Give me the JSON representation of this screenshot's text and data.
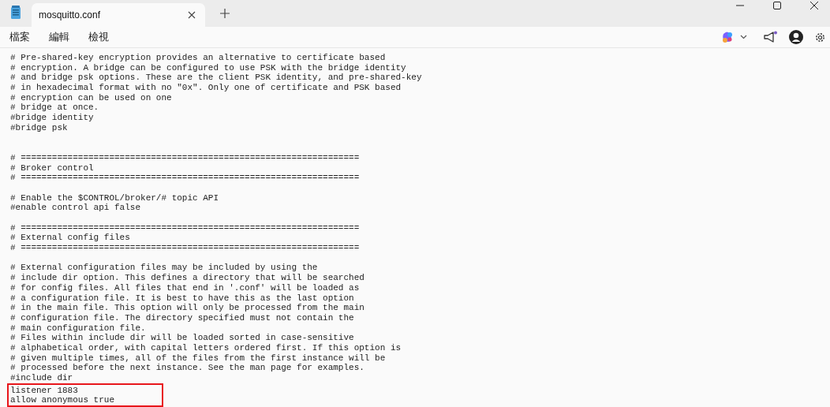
{
  "window": {
    "tabs": [
      {
        "label": "mosquitto.conf",
        "selected": true
      }
    ]
  },
  "menu": [
    {
      "label": "檔案"
    },
    {
      "label": "編輯"
    },
    {
      "label": "檢視"
    }
  ],
  "editor": {
    "lines": [
      {
        "kind": "text",
        "text": "# Pre-shared-key encryption provides an alternative to certificate based"
      },
      {
        "kind": "text",
        "text": "# encryption. A bridge can be configured to use PSK with the bridge identity"
      },
      {
        "kind": "text",
        "text": "# and bridge psk options. These are the client PSK identity, and pre-shared-key"
      },
      {
        "kind": "text",
        "text": "# in hexadecimal format with no \"0x\". Only one of certificate and PSK based"
      },
      {
        "kind": "text",
        "text": "# encryption can be used on one"
      },
      {
        "kind": "text",
        "text": "# bridge at once."
      },
      {
        "kind": "text",
        "text": "#bridge identity"
      },
      {
        "kind": "text",
        "text": "#bridge psk"
      },
      {
        "kind": "blank"
      },
      {
        "kind": "blank"
      },
      {
        "kind": "text",
        "text": "# ================================================================="
      },
      {
        "kind": "text",
        "text": "# Broker control"
      },
      {
        "kind": "text",
        "text": "# ================================================================="
      },
      {
        "kind": "blank"
      },
      {
        "kind": "text",
        "text": "# Enable the $CONTROL/broker/# topic API"
      },
      {
        "kind": "text",
        "text": "#enable control api false"
      },
      {
        "kind": "blank"
      },
      {
        "kind": "text",
        "text": "# ================================================================="
      },
      {
        "kind": "text",
        "text": "# External config files"
      },
      {
        "kind": "text",
        "text": "# ================================================================="
      },
      {
        "kind": "blank"
      },
      {
        "kind": "text",
        "text": "# External configuration files may be included by using the"
      },
      {
        "kind": "text",
        "text": "# include dir option. This defines a directory that will be searched"
      },
      {
        "kind": "text",
        "text": "# for config files. All files that end in '.conf' will be loaded as"
      },
      {
        "kind": "text",
        "text": "# a configuration file. It is best to have this as the last option"
      },
      {
        "kind": "text",
        "text": "# in the main file. This option will only be processed from the main"
      },
      {
        "kind": "text",
        "text": "# configuration file. The directory specified must not contain the"
      },
      {
        "kind": "text",
        "text": "# main configuration file."
      },
      {
        "kind": "text",
        "text": "# Files within include dir will be loaded sorted in case-sensitive"
      },
      {
        "kind": "text",
        "text": "# alphabetical order, with capital letters ordered first. If this option is"
      },
      {
        "kind": "text",
        "text": "# given multiple times, all of the files from the first instance will be"
      },
      {
        "kind": "text",
        "text": "# processed before the next instance. See the man page for examples."
      },
      {
        "kind": "text",
        "text": "#include dir"
      }
    ],
    "highlighted_lines": [
      "listener 1883",
      "allow anonymous true"
    ]
  }
}
